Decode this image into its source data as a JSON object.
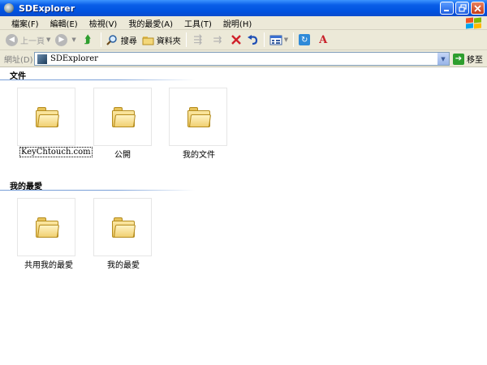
{
  "window": {
    "title": "SDExplorer"
  },
  "menu": {
    "items": [
      "檔案(F)",
      "編輯(E)",
      "檢視(V)",
      "我的最愛(A)",
      "工具(T)",
      "說明(H)"
    ]
  },
  "toolbar": {
    "back_label": "上一頁",
    "search_label": "搜尋",
    "folders_label": "資料夾"
  },
  "address": {
    "label": "網址(D)",
    "value": "SDExplorer",
    "go_label": "移至"
  },
  "sections": {
    "documents": {
      "title": "文件",
      "items": [
        "KeyChtouch.com",
        "公開",
        "我的文件"
      ]
    },
    "favorites": {
      "title": "我的最愛",
      "items": [
        "共用我的最愛",
        "我的最愛"
      ]
    }
  },
  "icons": {
    "folder": "folder-icon",
    "back": "back-arrow-icon",
    "forward": "forward-arrow-icon",
    "up": "up-folder-icon",
    "search": "search-icon",
    "delete": "delete-icon",
    "undo": "undo-icon",
    "views": "views-icon"
  },
  "colors": {
    "titlebar": "#0a5fe8",
    "chrome": "#ece9d8",
    "section_line": "#7aa0d8"
  }
}
